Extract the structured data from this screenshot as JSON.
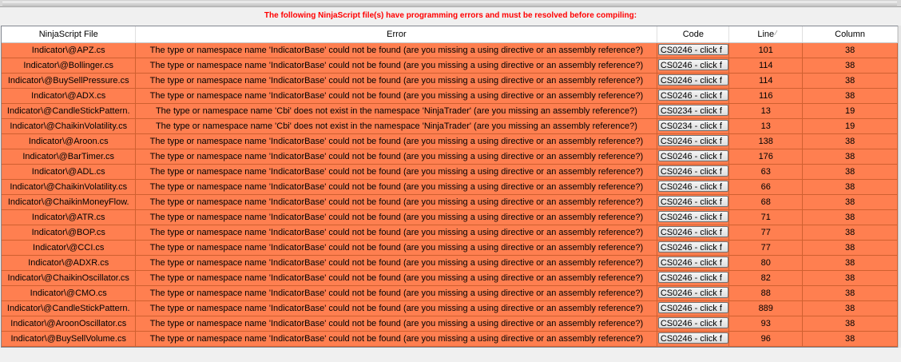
{
  "banner": "The following NinjaScript file(s) have programming errors and must be resolved before compiling:",
  "columns": {
    "file": "NinjaScript File",
    "error": "Error",
    "code": "Code",
    "line": "Line",
    "column": "Column"
  },
  "rows": [
    {
      "file": "Indicator\\@APZ.cs",
      "error": "The type or namespace name 'IndicatorBase' could not be found (are you missing a using directive or an assembly reference?)",
      "code": "CS0246 - click f",
      "line": "101",
      "column": "38"
    },
    {
      "file": "Indicator\\@Bollinger.cs",
      "error": "The type or namespace name 'IndicatorBase' could not be found (are you missing a using directive or an assembly reference?)",
      "code": "CS0246 - click f",
      "line": "114",
      "column": "38"
    },
    {
      "file": "Indicator\\@BuySellPressure.cs",
      "error": "The type or namespace name 'IndicatorBase' could not be found (are you missing a using directive or an assembly reference?)",
      "code": "CS0246 - click f",
      "line": "114",
      "column": "38"
    },
    {
      "file": "Indicator\\@ADX.cs",
      "error": "The type or namespace name 'IndicatorBase' could not be found (are you missing a using directive or an assembly reference?)",
      "code": "CS0246 - click f",
      "line": "116",
      "column": "38"
    },
    {
      "file": "Indicator\\@CandleStickPattern.",
      "error": "The type or namespace name 'Cbi' does not exist in the namespace 'NinjaTrader' (are you missing an assembly reference?)",
      "code": "CS0234 - click f",
      "line": "13",
      "column": "19"
    },
    {
      "file": "Indicator\\@ChaikinVolatility.cs",
      "error": "The type or namespace name 'Cbi' does not exist in the namespace 'NinjaTrader' (are you missing an assembly reference?)",
      "code": "CS0234 - click f",
      "line": "13",
      "column": "19"
    },
    {
      "file": "Indicator\\@Aroon.cs",
      "error": "The type or namespace name 'IndicatorBase' could not be found (are you missing a using directive or an assembly reference?)",
      "code": "CS0246 - click f",
      "line": "138",
      "column": "38"
    },
    {
      "file": "Indicator\\@BarTimer.cs",
      "error": "The type or namespace name 'IndicatorBase' could not be found (are you missing a using directive or an assembly reference?)",
      "code": "CS0246 - click f",
      "line": "176",
      "column": "38"
    },
    {
      "file": "Indicator\\@ADL.cs",
      "error": "The type or namespace name 'IndicatorBase' could not be found (are you missing a using directive or an assembly reference?)",
      "code": "CS0246 - click f",
      "line": "63",
      "column": "38"
    },
    {
      "file": "Indicator\\@ChaikinVolatility.cs",
      "error": "The type or namespace name 'IndicatorBase' could not be found (are you missing a using directive or an assembly reference?)",
      "code": "CS0246 - click f",
      "line": "66",
      "column": "38"
    },
    {
      "file": "Indicator\\@ChaikinMoneyFlow.",
      "error": "The type or namespace name 'IndicatorBase' could not be found (are you missing a using directive or an assembly reference?)",
      "code": "CS0246 - click f",
      "line": "68",
      "column": "38"
    },
    {
      "file": "Indicator\\@ATR.cs",
      "error": "The type or namespace name 'IndicatorBase' could not be found (are you missing a using directive or an assembly reference?)",
      "code": "CS0246 - click f",
      "line": "71",
      "column": "38"
    },
    {
      "file": "Indicator\\@BOP.cs",
      "error": "The type or namespace name 'IndicatorBase' could not be found (are you missing a using directive or an assembly reference?)",
      "code": "CS0246 - click f",
      "line": "77",
      "column": "38"
    },
    {
      "file": "Indicator\\@CCI.cs",
      "error": "The type or namespace name 'IndicatorBase' could not be found (are you missing a using directive or an assembly reference?)",
      "code": "CS0246 - click f",
      "line": "77",
      "column": "38"
    },
    {
      "file": "Indicator\\@ADXR.cs",
      "error": "The type or namespace name 'IndicatorBase' could not be found (are you missing a using directive or an assembly reference?)",
      "code": "CS0246 - click f",
      "line": "80",
      "column": "38"
    },
    {
      "file": "Indicator\\@ChaikinOscillator.cs",
      "error": "The type or namespace name 'IndicatorBase' could not be found (are you missing a using directive or an assembly reference?)",
      "code": "CS0246 - click f",
      "line": "82",
      "column": "38"
    },
    {
      "file": "Indicator\\@CMO.cs",
      "error": "The type or namespace name 'IndicatorBase' could not be found (are you missing a using directive or an assembly reference?)",
      "code": "CS0246 - click f",
      "line": "88",
      "column": "38"
    },
    {
      "file": "Indicator\\@CandleStickPattern.",
      "error": "The type or namespace name 'IndicatorBase' could not be found (are you missing a using directive or an assembly reference?)",
      "code": "CS0246 - click f",
      "line": "889",
      "column": "38"
    },
    {
      "file": "Indicator\\@AroonOscillator.cs",
      "error": "The type or namespace name 'IndicatorBase' could not be found (are you missing a using directive or an assembly reference?)",
      "code": "CS0246 - click f",
      "line": "93",
      "column": "38"
    },
    {
      "file": "Indicator\\@BuySellVolume.cs",
      "error": "The type or namespace name 'IndicatorBase' could not be found (are you missing a using directive or an assembly reference?)",
      "code": "CS0246 - click f",
      "line": "96",
      "column": "38"
    }
  ],
  "colors": {
    "row_background": "#ff7f50",
    "banner_text": "#ff0000",
    "grid_empty": "#ababab"
  }
}
